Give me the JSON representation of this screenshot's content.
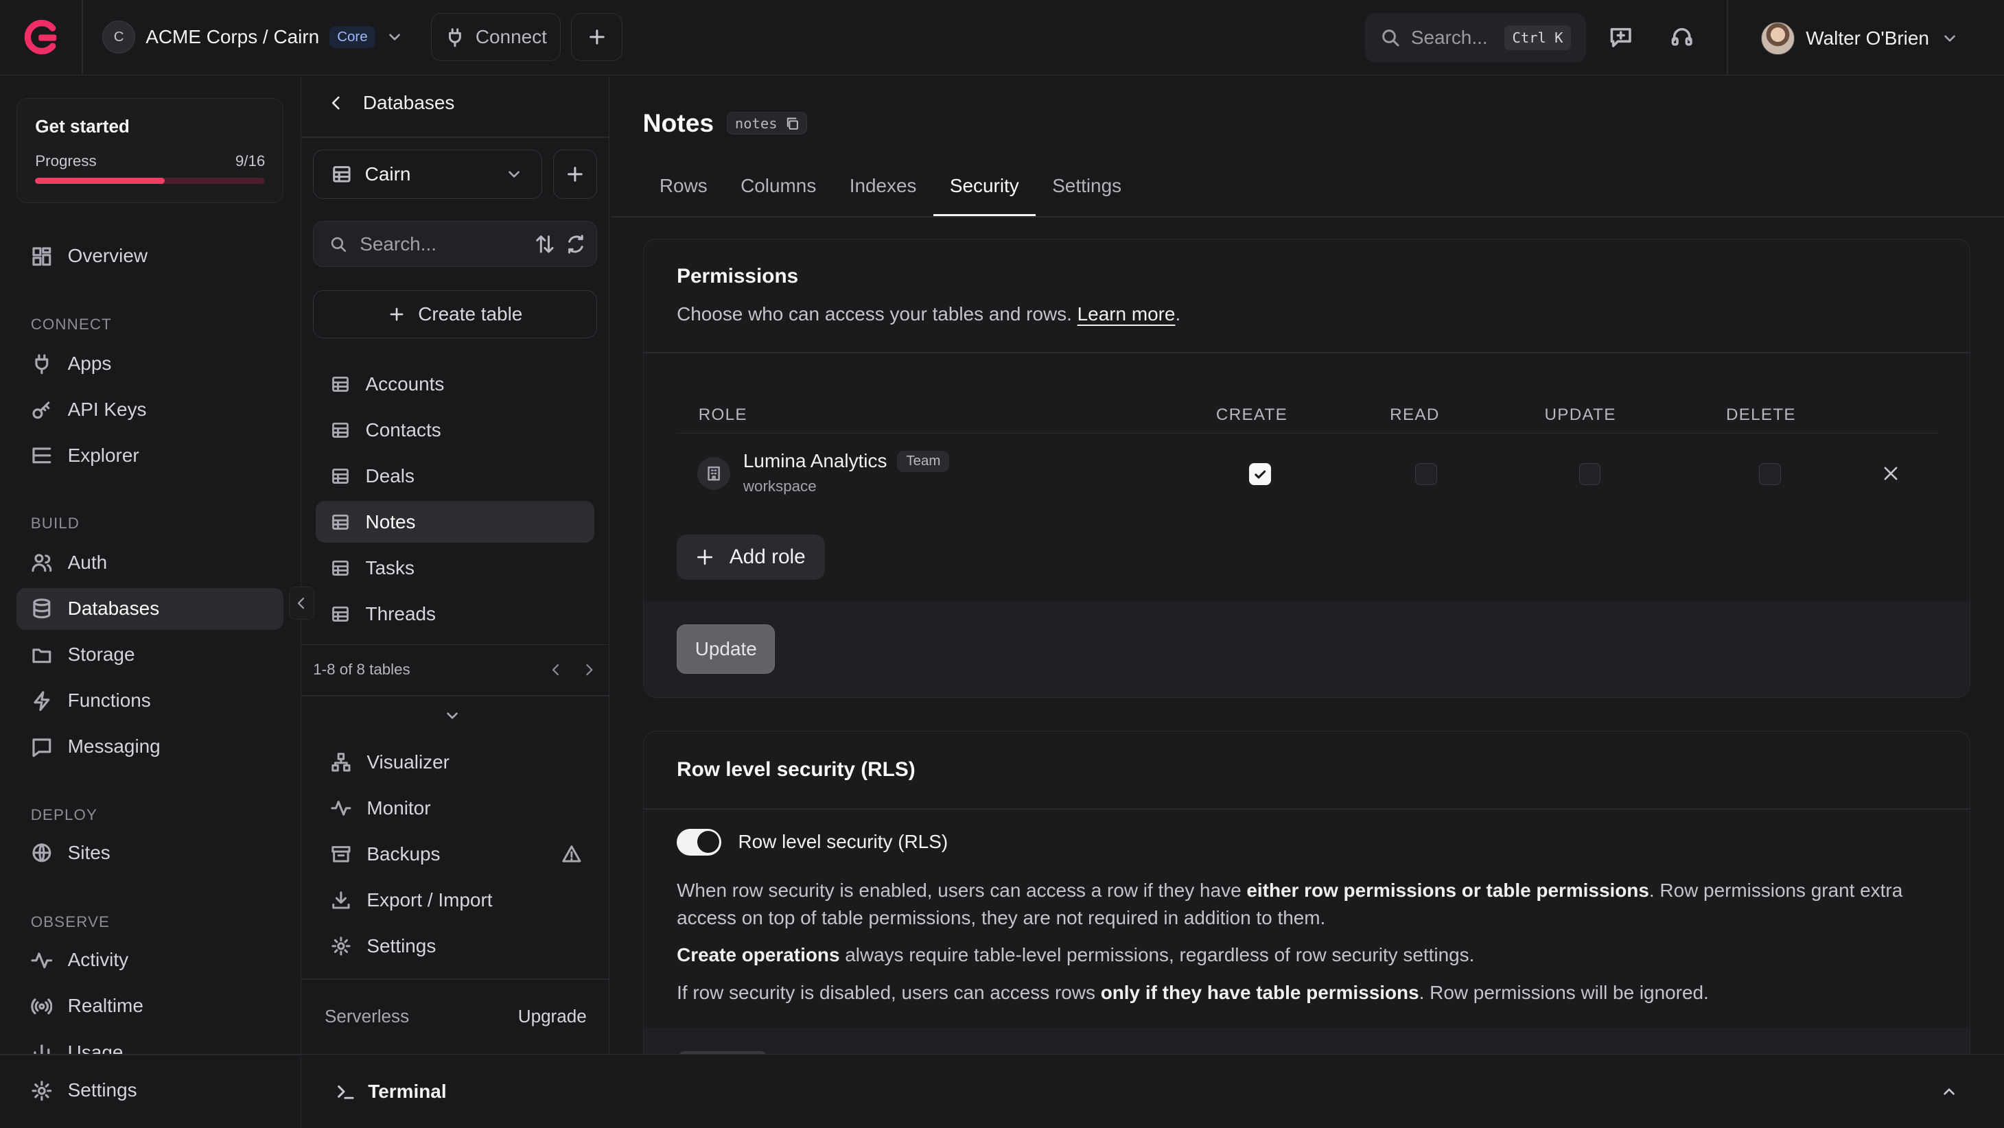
{
  "topbar": {
    "org_initial": "C",
    "org_name": "ACME Corps / Cairn",
    "plan_badge": "Core",
    "connect_label": "Connect",
    "search_placeholder": "Search...",
    "search_shortcut": "Ctrl K",
    "user_name": "Walter O'Brien"
  },
  "sidebar": {
    "get_started": {
      "title": "Get started",
      "progress_label": "Progress",
      "progress_text": "9/16",
      "progress_fraction": 0.5625
    },
    "overview": "Overview",
    "sections": {
      "connect": "CONNECT",
      "build": "BUILD",
      "deploy": "DEPLOY",
      "observe": "OBSERVE"
    },
    "connect_items": [
      "Apps",
      "API Keys",
      "Explorer"
    ],
    "build_items": [
      "Auth",
      "Databases",
      "Storage",
      "Functions",
      "Messaging"
    ],
    "deploy_items": [
      "Sites"
    ],
    "observe_items": [
      "Activity",
      "Realtime",
      "Usage"
    ],
    "settings": "Settings",
    "active_item": "Databases"
  },
  "db_panel": {
    "back_label": "Databases",
    "database_name": "Cairn",
    "search_placeholder": "Search...",
    "create_table_label": "Create table",
    "tables": [
      "Accounts",
      "Contacts",
      "Deals",
      "Notes",
      "Tasks",
      "Threads"
    ],
    "active_table": "Notes",
    "pager_text": "1-8 of 8 tables",
    "tools": [
      "Visualizer",
      "Monitor",
      "Backups",
      "Export / Import",
      "Settings"
    ],
    "plan_name": "Serverless",
    "upgrade_label": "Upgrade"
  },
  "main": {
    "title": "Notes",
    "table_id": "notes",
    "tabs": [
      "Rows",
      "Columns",
      "Indexes",
      "Security",
      "Settings"
    ],
    "active_tab": "Security",
    "permissions": {
      "title": "Permissions",
      "description": "Choose who can access your tables and rows.",
      "learn_more": "Learn more",
      "columns": [
        "ROLE",
        "CREATE",
        "READ",
        "UPDATE",
        "DELETE"
      ],
      "rows": [
        {
          "name": "Lumina Analytics",
          "badge": "Team",
          "type": "workspace",
          "create": true,
          "read": false,
          "update": false,
          "delete": false
        }
      ],
      "add_role_label": "Add role",
      "update_label": "Update"
    },
    "rls": {
      "title": "Row level security (RLS)",
      "toggle_label": "Row level security (RLS)",
      "enabled": true,
      "p1_a": "When row security is enabled, users can access a row if they have ",
      "p1_b": "either row permissions or table permissions",
      "p1_c": ". Row permissions grant extra access on top of table permissions, they are not required in addition to them.",
      "p2_a": "Create operations",
      "p2_b": " always require table-level permissions, regardless of row security settings.",
      "p3_a": "If row security is disabled, users can access rows ",
      "p3_b": "only if they have table permissions",
      "p3_c": ". Row permissions will be ignored."
    }
  },
  "terminal": {
    "label": "Terminal"
  }
}
